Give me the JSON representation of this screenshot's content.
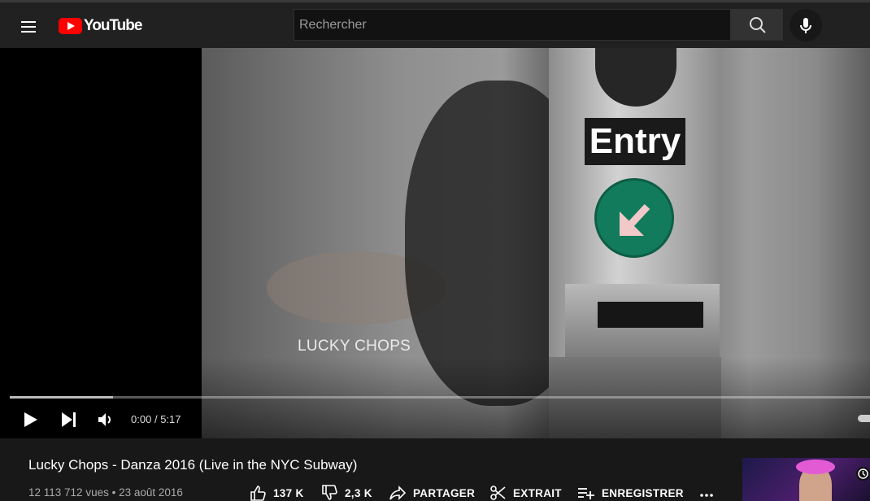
{
  "header": {
    "logo_text": "YouTube",
    "search_placeholder": "Rechercher",
    "brand_color": "#ff0000"
  },
  "player": {
    "caption": "LUCKY CHOPS",
    "sign_text": "Entry",
    "time_current": "0:00",
    "time_separator": "/",
    "time_total": "5:17",
    "progress_fraction": 0.12,
    "icons": {
      "play": "play-icon",
      "next": "next-icon",
      "volume": "volume-icon"
    }
  },
  "video": {
    "title": "Lucky Chops - Danza 2016 (Live in the NYC Subway)",
    "views": "12 113 712 vues",
    "separator": "•",
    "date": "23 août 2016"
  },
  "actions": {
    "like": "137 K",
    "dislike": "2,3 K",
    "share": "PARTAGER",
    "clip": "EXTRAIT",
    "save": "ENREGISTRER"
  }
}
